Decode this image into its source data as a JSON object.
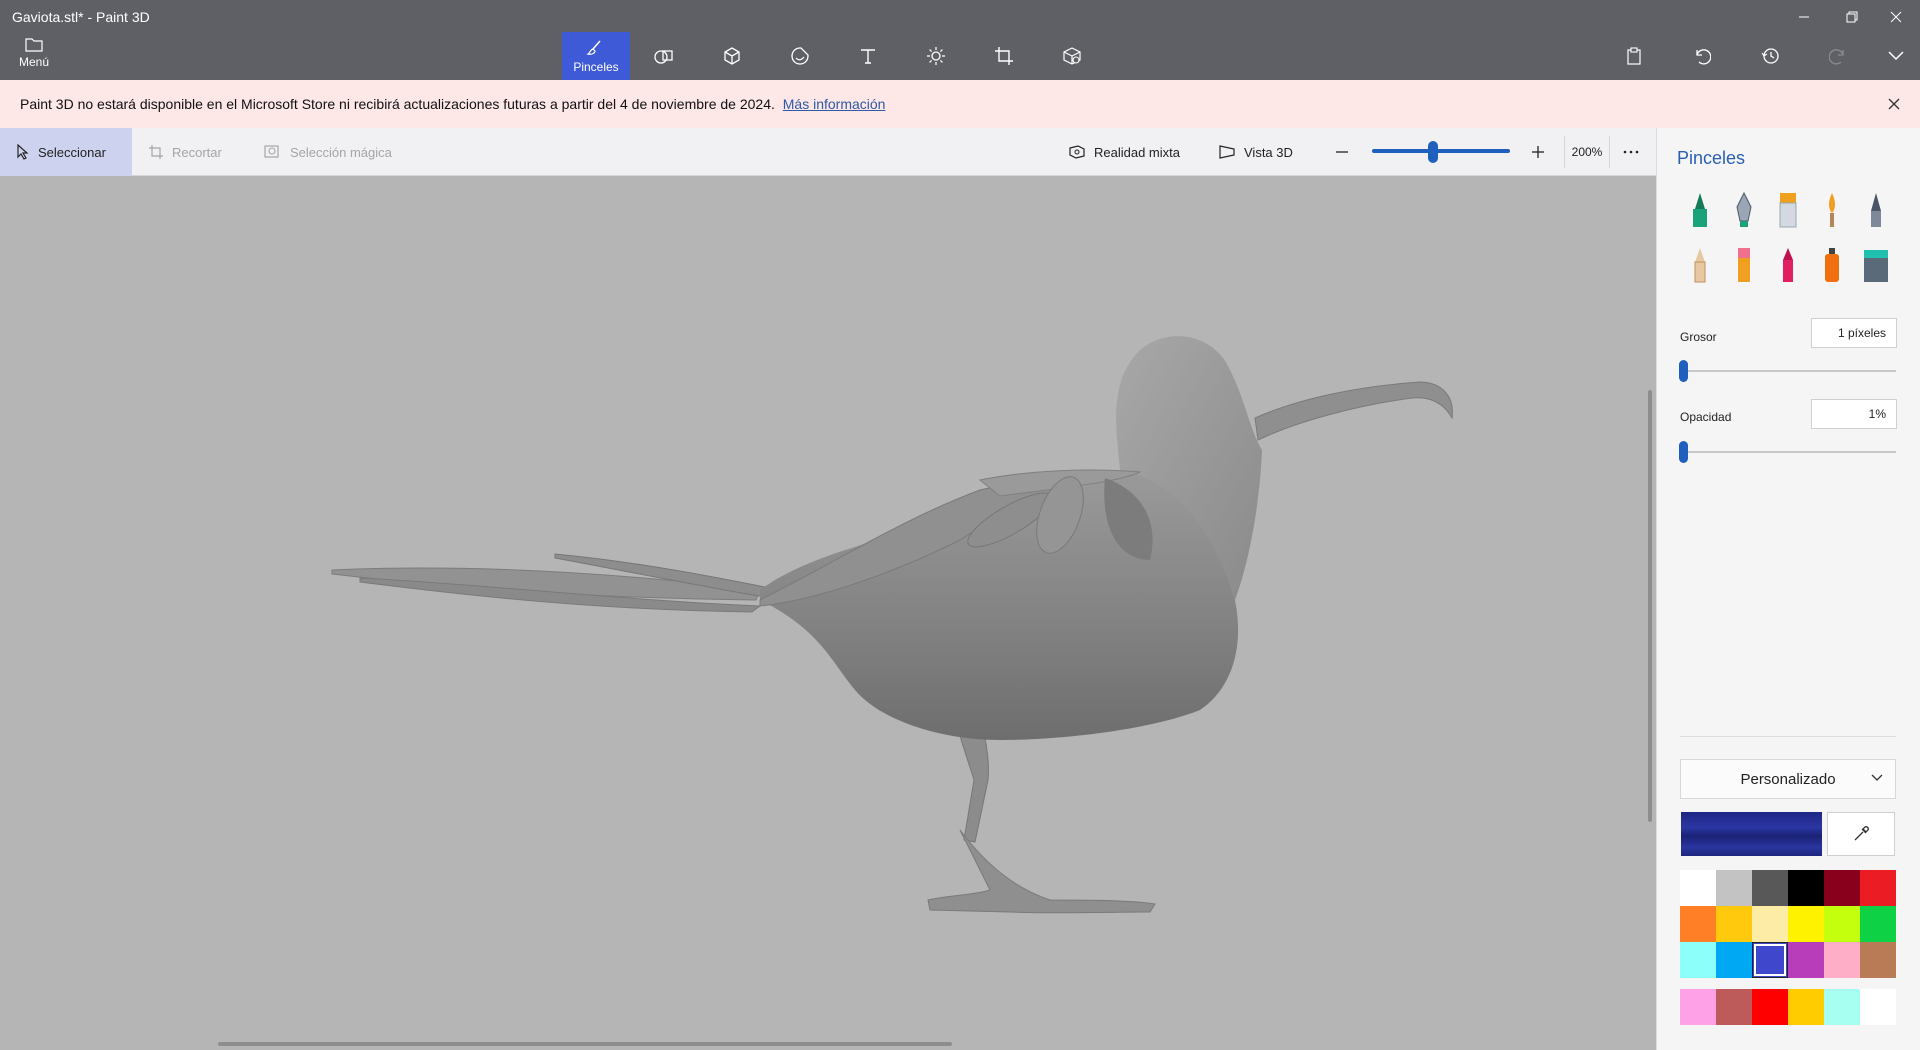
{
  "window": {
    "title": "Gaviota.stl* - Paint 3D"
  },
  "menu": {
    "label": "Menú"
  },
  "tools": [
    {
      "name": "Pinceles",
      "icon": "brush-icon",
      "active": true
    },
    {
      "name": "",
      "icon": "2d-shapes-icon"
    },
    {
      "name": "",
      "icon": "3d-shapes-icon"
    },
    {
      "name": "",
      "icon": "stickers-icon"
    },
    {
      "name": "",
      "icon": "text-icon"
    },
    {
      "name": "",
      "icon": "effects-icon"
    },
    {
      "name": "",
      "icon": "canvas-icon"
    },
    {
      "name": "",
      "icon": "3d-library-icon"
    }
  ],
  "banner": {
    "text": "Paint 3D no estará disponible en el Microsoft Store ni recibirá actualizaciones futuras a partir del 4 de noviembre de 2024.",
    "link": "Más información"
  },
  "toolbar": {
    "select": "Seleccionar",
    "crop": "Recortar",
    "magic_select": "Selección mágica",
    "mixed_reality": "Realidad mixta",
    "view_3d": "Vista 3D",
    "zoom": "200%",
    "zoom_fraction": 0.44
  },
  "panel": {
    "title": "Pinceles",
    "thickness_label": "Grosor",
    "thickness_value": "1 píxeles",
    "opacity_label": "Opacidad",
    "opacity_value": "1%",
    "palette_dropdown": "Personalizado",
    "current_color": "#2a33a0",
    "brushes": [
      "marker",
      "calligraphy-pen",
      "oil-brush",
      "watercolor",
      "pixel-pen",
      "pencil",
      "eraser",
      "crayon",
      "spray-can",
      "fill"
    ],
    "colors": [
      [
        "#ffffff",
        "#c3c3c3",
        "#585858",
        "#000000",
        "#88001b",
        "#ec1c24"
      ],
      [
        "#ff7f27",
        "#ffc90e",
        "#fdeca6",
        "#fff200",
        "#c4ff0e",
        "#0ed145"
      ],
      [
        "#8cfffb",
        "#00a8f3",
        "#3f48cc",
        "#b83dba",
        "#ffaec8",
        "#b97a56"
      ]
    ],
    "custom_colors": [
      "#ffa1e7",
      "#bd5b5b",
      "#ff0000",
      "#ffcc00",
      "#a6fff0",
      "#ffffff"
    ],
    "selected_color": "#3f48cc"
  }
}
